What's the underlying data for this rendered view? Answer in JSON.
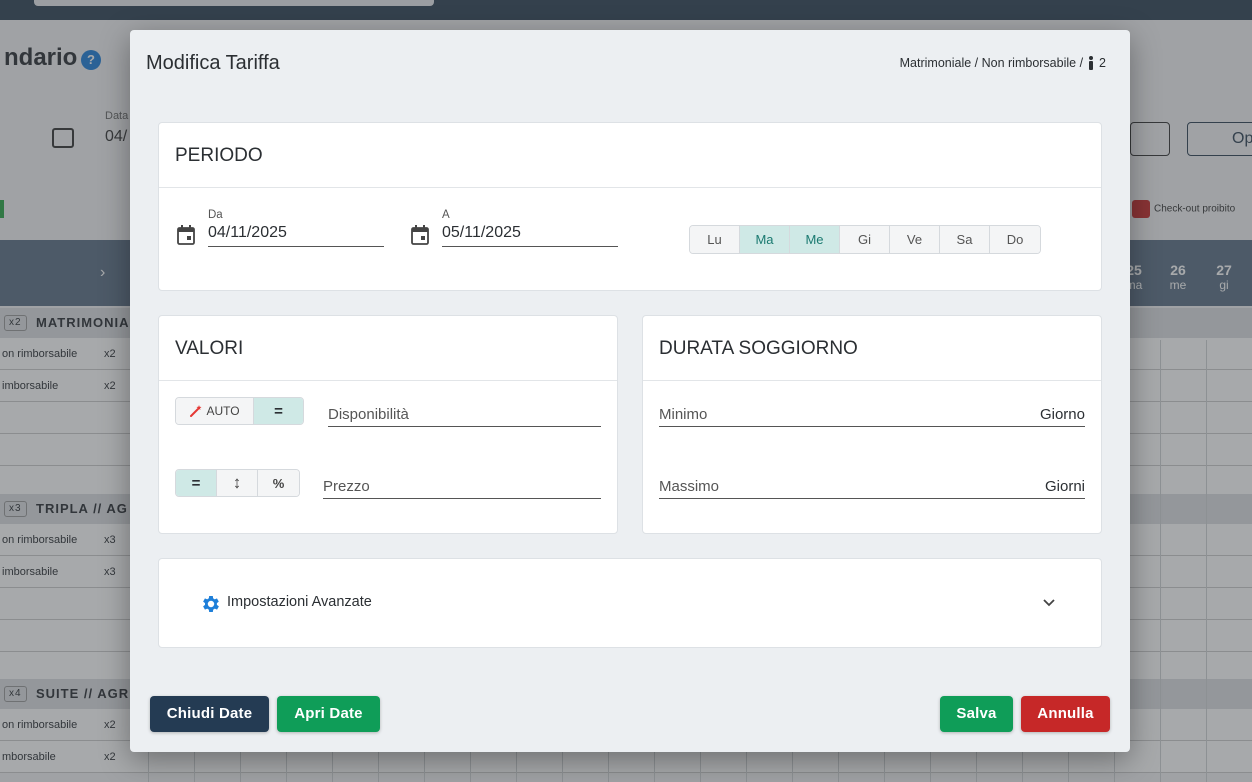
{
  "background": {
    "page_title": "ndario",
    "help_label": "?",
    "date_label": "Data",
    "date_value": "04/",
    "checkout_forbidden": "Check-out proibito",
    "options_label": "Op",
    "days": [
      {
        "num": "25",
        "name": "ma"
      },
      {
        "num": "26",
        "name": "me"
      },
      {
        "num": "27",
        "name": "gi"
      }
    ],
    "sections": [
      {
        "count": "x2",
        "label": "MATRIMONIA"
      },
      {
        "count": "x3",
        "label": "TRIPLA // AG"
      },
      {
        "count": "x4",
        "label": "SUITE // AGR"
      }
    ],
    "rows": [
      {
        "label": "on rimborsabile",
        "occ": "x2"
      },
      {
        "label": "imborsabile",
        "occ": "x2"
      },
      {
        "label": "on rimborsabile",
        "occ": "x3"
      },
      {
        "label": "imborsabile",
        "occ": "x3"
      },
      {
        "label": "on rimborsabile",
        "occ": "x2"
      },
      {
        "label": "mborsabile",
        "occ": "x2"
      }
    ]
  },
  "modal": {
    "title": "Modifica Tariffa",
    "subtitle": "Matrimoniale / Non rimborsabile /",
    "occupancy": "2",
    "periodo": {
      "heading": "PERIODO",
      "from_label": "Da",
      "from_value": "04/11/2025",
      "to_label": "A",
      "to_value": "05/11/2025",
      "weekdays": [
        {
          "label": "Lu",
          "active": false
        },
        {
          "label": "Ma",
          "active": true
        },
        {
          "label": "Me",
          "active": true
        },
        {
          "label": "Gi",
          "active": false
        },
        {
          "label": "Ve",
          "active": false
        },
        {
          "label": "Sa",
          "active": false
        },
        {
          "label": "Do",
          "active": false
        }
      ]
    },
    "valori": {
      "heading": "VALORI",
      "auto_label": "AUTO",
      "equals_label": "=",
      "availability_placeholder": "Disponibilità",
      "price_mode_equals": "=",
      "price_mode_updown": "↕",
      "price_mode_percent": "%",
      "price_placeholder": "Prezzo"
    },
    "durata": {
      "heading": "DURATA SOGGIORNO",
      "min_placeholder": "Minimo",
      "min_unit": "Giorno",
      "max_placeholder": "Massimo",
      "max_unit": "Giorni"
    },
    "advanced": {
      "label": "Impostazioni Avanzate"
    },
    "footer": {
      "close_dates": "Chiudi Date",
      "open_dates": "Apri Date",
      "save": "Salva",
      "cancel": "Annulla"
    },
    "colors": {
      "dark": "#243b53",
      "green": "#0f9d58",
      "red": "#c62828",
      "teal_active": "#cfe9e6",
      "gear": "#1e7fd9"
    }
  }
}
